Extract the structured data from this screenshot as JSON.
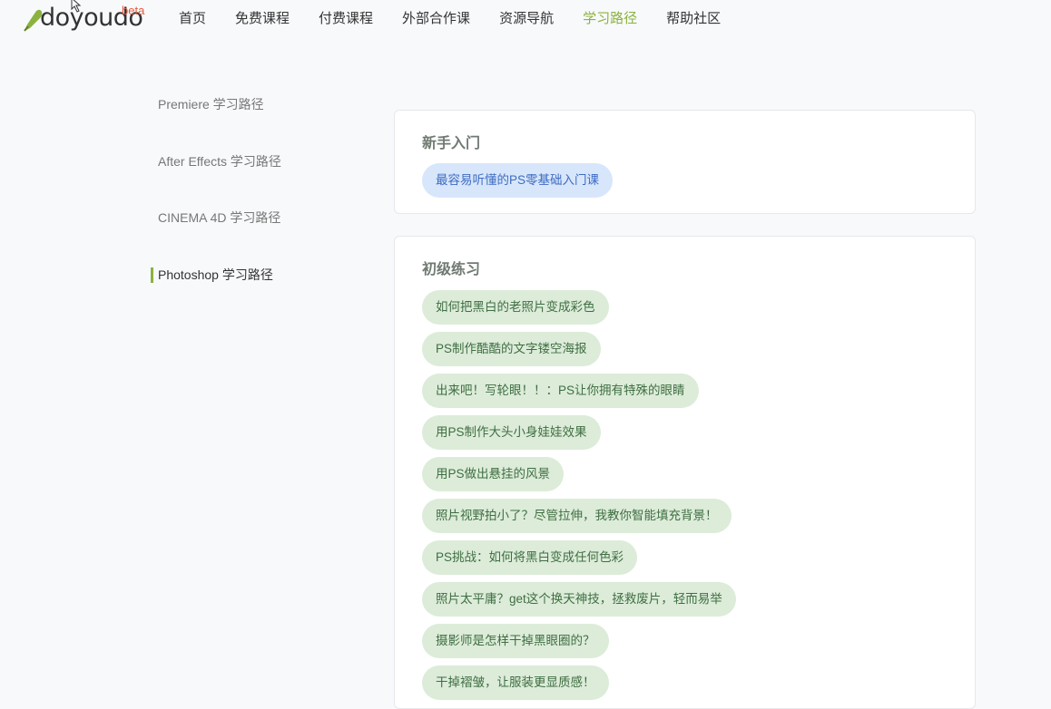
{
  "brand": {
    "name": "doyoudo",
    "badge": "beta",
    "mark_color": "#8bb23f",
    "badge_color": "#e55a3c"
  },
  "nav": {
    "items": [
      {
        "label": "首页"
      },
      {
        "label": "免费课程"
      },
      {
        "label": "付费课程"
      },
      {
        "label": "外部合作课"
      },
      {
        "label": "资源导航"
      },
      {
        "label": "学习路径",
        "active": true
      },
      {
        "label": "帮助社区"
      }
    ],
    "active_color": "#8bb23f"
  },
  "sidebar": {
    "items": [
      {
        "label": "Premiere 学习路径"
      },
      {
        "label": "After Effects 学习路径"
      },
      {
        "label": "CINEMA 4D 学习路径"
      },
      {
        "label": "Photoshop 学习路径",
        "active": true
      }
    ]
  },
  "sections": [
    {
      "title": "新手入门",
      "courses": [
        "最容易听懂的PS零基础入门课"
      ]
    },
    {
      "title": "初级练习",
      "courses": [
        "如何把黑白的老照片变成彩色",
        "PS制作酷酷的文字镂空海报",
        "出来吧！写轮眼！！：PS让你拥有特殊的眼睛",
        "用PS制作大头小身娃娃效果",
        "用PS做出悬挂的风景",
        "照片视野拍小了？尽管拉伸，我教你智能填充背景！",
        "PS挑战：如何将黑白变成任何色彩",
        "照片太平庸？get这个换天神技，拯救废片，轻而易举",
        "摄影师是怎样干掉黑眼圈的？",
        "干掉褶皱，让服装更显质感！"
      ]
    }
  ]
}
